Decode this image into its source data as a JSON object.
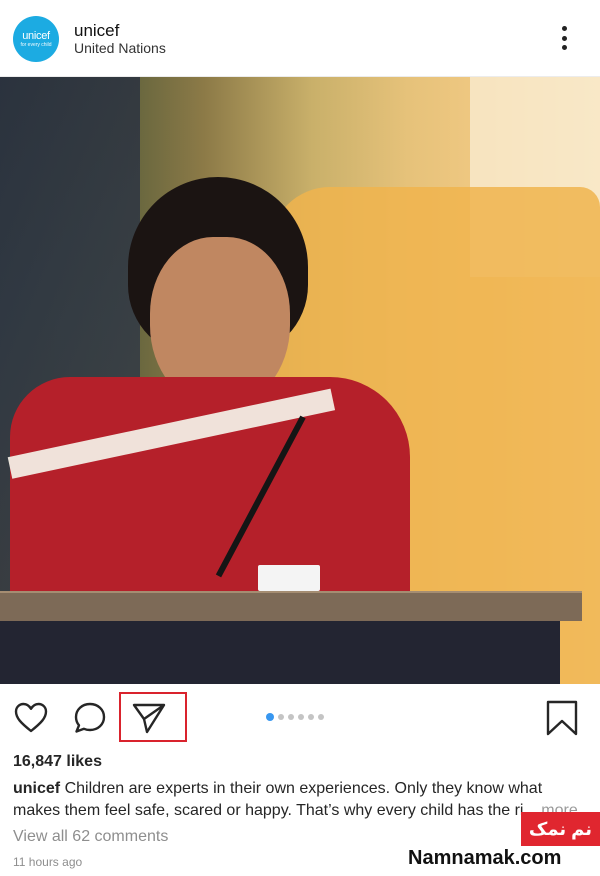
{
  "post": {
    "avatar": {
      "brand": "unicef",
      "tagline": "for every child"
    },
    "username": "unicef",
    "location": "United Nations",
    "likes": "16,847 likes",
    "caption": {
      "user": "unicef",
      "text": " Children are experts in their own experiences. Only they know what makes them feel safe, scared or happy. That’s why every child has the ri...",
      "more": " more"
    },
    "view_comments": "View all 62 comments",
    "timestamp": "11 hours ago",
    "carousel": {
      "total": 6,
      "active_index": 0,
      "active_color": "#3897f0"
    }
  },
  "icons": {
    "menu": "more-vertical-icon",
    "like": "heart-icon",
    "comment": "comment-bubble-icon",
    "share": "paper-plane-icon",
    "save": "bookmark-icon"
  },
  "highlight_color": "#d9232d",
  "watermark": {
    "persian": "نم نمک",
    "english": "Namnamak.com"
  }
}
